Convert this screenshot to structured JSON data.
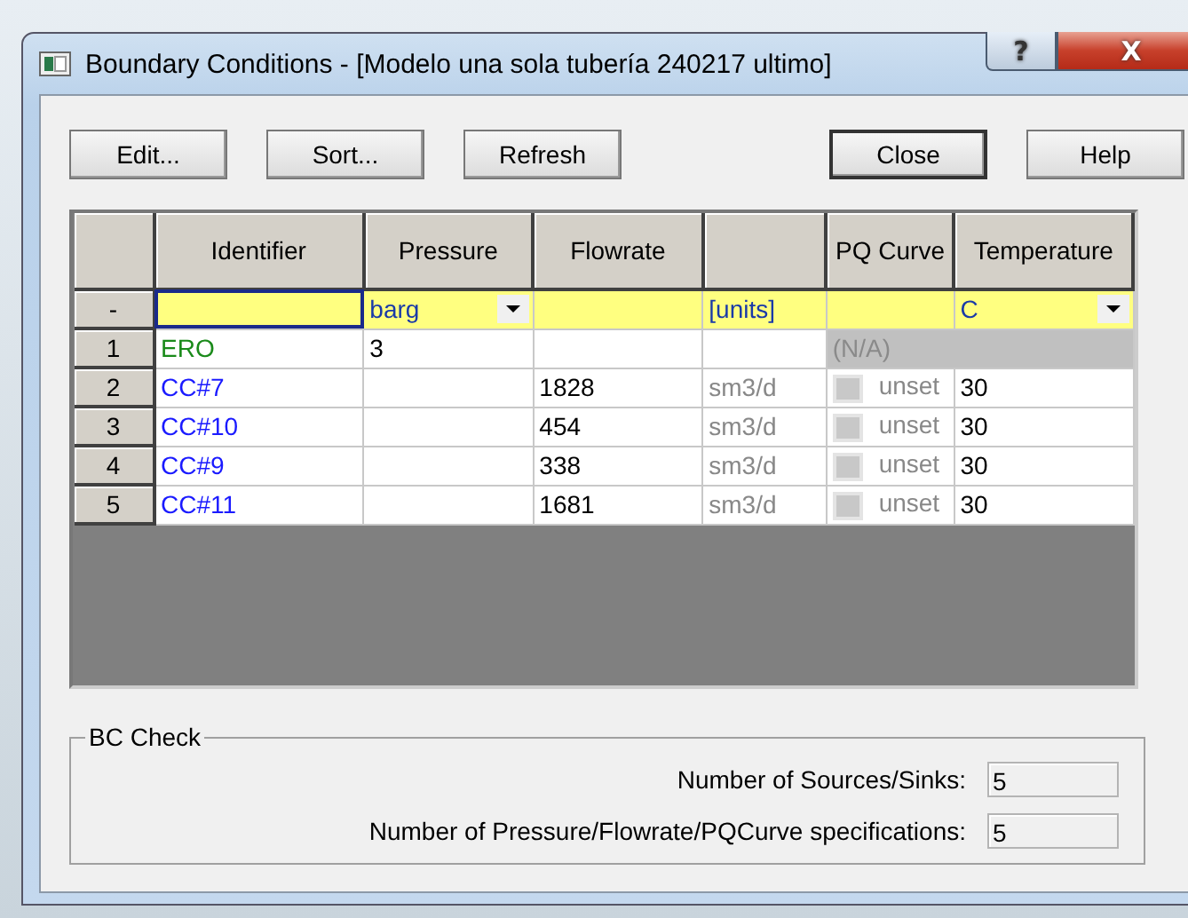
{
  "window": {
    "title": "Boundary Conditions - [Modelo una sola tubería 240217 ultimo]",
    "help_glyph": "?",
    "close_glyph": "X"
  },
  "buttons": [
    {
      "label": "Edit...",
      "default": false
    },
    {
      "label": "Sort...",
      "default": false
    },
    {
      "label": "Refresh",
      "default": false
    },
    {
      "label": "Close",
      "default": true
    },
    {
      "label": "Help",
      "default": false
    }
  ],
  "grid": {
    "columns": [
      {
        "label": "Identifier"
      },
      {
        "label": "Pressure"
      },
      {
        "label": "Flowrate"
      },
      {},
      {
        "label": "PQ Curve"
      },
      {
        "label": "Temperature"
      }
    ],
    "units_row": {
      "marker": "-",
      "cells": [
        {
          "kind": "input",
          "selected": true
        },
        {
          "kind": "dropdown",
          "value": "barg",
          "selected": false
        },
        {
          "kind": "input",
          "selected": false
        },
        {
          "kind": "text",
          "value": "[units]",
          "selected": false
        },
        {
          "kind": "input",
          "selected": false
        },
        {
          "kind": "dropdown",
          "value": "C",
          "selected": false
        }
      ]
    },
    "rows": [
      {
        "number": "1",
        "identifier": "ERO",
        "color": "#1a8a1a",
        "pressure": "3",
        "pq": {
          "kind": "na",
          "text": "(N/A)"
        }
      },
      {
        "number": "2",
        "identifier": "CC#7",
        "color": "#1a1aff",
        "flowrate": "1828",
        "unit": "sm3/d",
        "pq": {
          "kind": "checkbox",
          "checked": false,
          "text": "unset"
        },
        "temperature": "30"
      },
      {
        "number": "3",
        "identifier": "CC#10",
        "color": "#1a1aff",
        "flowrate": "454",
        "unit": "sm3/d",
        "pq": {
          "kind": "checkbox",
          "checked": false,
          "text": "unset"
        },
        "temperature": "30"
      },
      {
        "number": "4",
        "identifier": "CC#9",
        "color": "#1a1aff",
        "flowrate": "338",
        "unit": "sm3/d",
        "pq": {
          "kind": "checkbox",
          "checked": false,
          "text": "unset"
        },
        "temperature": "30"
      },
      {
        "number": "5",
        "identifier": "CC#11",
        "color": "#1a1aff",
        "flowrate": "1681",
        "unit": "sm3/d",
        "pq": {
          "kind": "checkbox",
          "checked": false,
          "text": "unset"
        },
        "temperature": "30"
      }
    ]
  },
  "bc_check": {
    "title": "BC Check",
    "fields": [
      {
        "label": "Number of Sources/Sinks:",
        "value": "5"
      },
      {
        "label": "Number of Pressure/Flowrate/PQCurve specifications:",
        "value": "5"
      }
    ]
  }
}
